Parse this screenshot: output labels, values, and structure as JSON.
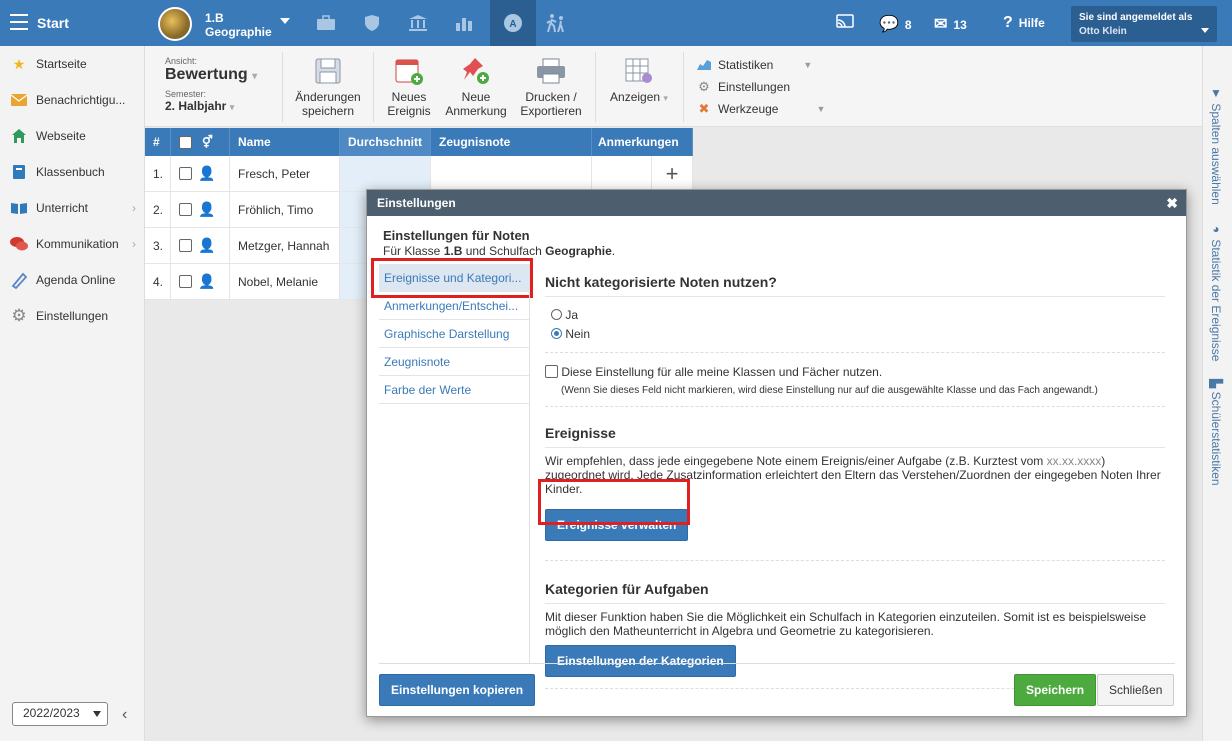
{
  "topbar": {
    "start_label": "Start",
    "class_name": "1.B",
    "subject": "Geographie",
    "messages_count": "8",
    "mail_count": "13",
    "help_label": "Hilfe",
    "logged_in_label": "Sie sind angemeldet als",
    "user_name": "Otto Klein",
    "nav_icons": [
      "briefcase-icon",
      "shield-icon",
      "institution-icon",
      "bar-chart-icon",
      "grade-icon",
      "walking-icon"
    ]
  },
  "sidebar": {
    "items": [
      {
        "label": "Startseite",
        "icon": "star-icon",
        "color": "#f2b51b"
      },
      {
        "label": "Benachrichtigu...",
        "icon": "envelope-icon",
        "color": "#e8a531"
      },
      {
        "label": "Webseite",
        "icon": "home-icon",
        "color": "#2f9a5a"
      },
      {
        "label": "Klassenbuch",
        "icon": "book-icon",
        "color": "#2f7ab8"
      },
      {
        "label": "Unterricht",
        "icon": "open-book-icon",
        "color": "#2f7ab8"
      },
      {
        "label": "Kommunikation",
        "icon": "chat-icon",
        "color": "#d0392e"
      },
      {
        "label": "Agenda Online",
        "icon": "pen-icon",
        "color": "#5a88c6"
      },
      {
        "label": "Einstellungen",
        "icon": "gear-icon",
        "color": "#888888"
      }
    ],
    "year": "2022/2023"
  },
  "toolbar": {
    "view_label": "Ansicht:",
    "view_value": "Bewertung",
    "semester_label": "Semester:",
    "semester_value": "2. Halbjahr",
    "save_line1": "Änderungen",
    "save_line2": "speichern",
    "event_line1": "Neues",
    "event_line2": "Ereignis",
    "note_line1": "Neue",
    "note_line2": "Anmerkung",
    "print_line1": "Drucken /",
    "print_line2": "Exportieren",
    "show_label": "Anzeigen",
    "stats_label": "Statistiken",
    "settings_label": "Einstellungen",
    "tools_label": "Werkzeuge"
  },
  "right_strip": {
    "columns": "Spalten auswählen",
    "stats": "Statistik der Ereignisse",
    "student_stats": "Schülerstatistiken"
  },
  "table": {
    "headers": {
      "num": "#",
      "name": "Name",
      "avg": "Durchschnitt",
      "grade": "Zeugnisnote",
      "notes": "Anmerkungen"
    },
    "rows": [
      {
        "num": "1.",
        "name": "Fresch, Peter"
      },
      {
        "num": "2.",
        "name": "Fröhlich, Timo"
      },
      {
        "num": "3.",
        "name": "Metzger, Hannah"
      },
      {
        "num": "4.",
        "name": "Nobel, Melanie"
      }
    ]
  },
  "modal": {
    "title": "Einstellungen",
    "heading": "Einstellungen für Noten",
    "sub_prefix": "Für Klasse ",
    "sub_class": "1.B",
    "sub_mid": " und Schulfach ",
    "sub_subject": "Geographie",
    "sub_end": ".",
    "nav": [
      "Ereignisse und Kategori...",
      "Anmerkungen/Entschei...",
      "Graphische Darstellung",
      "Zeugnisnote",
      "Farbe der Werte"
    ],
    "section1": {
      "title": "Nicht kategorisierte Noten nutzen?",
      "opt_yes": "Ja",
      "opt_no": "Nein",
      "apply_all": "Diese Einstellung für alle meine Klassen und Fächer nutzen.",
      "apply_hint": "(Wenn Sie dieses Feld nicht markieren, wird diese Einstellung nur auf die ausgewählte Klasse und das Fach angewandt.)"
    },
    "section2": {
      "title": "Ereignisse",
      "text_a": "Wir empfehlen, dass jede eingegebene Note einem Ereignis/einer Aufgabe (z.B. Kurztest vom ",
      "text_date": "xx.xx.xxxx",
      "text_b": ") zugeordnet wird. Jede Zusatzinformation erleichtert den Eltern das Verstehen/Zuordnen der eingegeben Noten Ihrer Kinder.",
      "button": "Ereignisse verwalten"
    },
    "section3": {
      "title": "Kategorien für Aufgaben",
      "text": "Mit dieser Funktion haben Sie die Möglichkeit ein Schulfach in Kategorien einzuteilen. Somit ist es beispielsweise möglich den Matheunterricht in Algebra und Geometrie zu kategorisieren.",
      "button": "Einstellungen der Kategorien"
    },
    "copy_button": "Einstellungen kopieren",
    "save_button": "Speichern",
    "close_button": "Schließen"
  },
  "colors": {
    "primary": "#3b7ab8",
    "header_dark": "#4d5e6e",
    "save_green": "#4caa3f",
    "highlight_red": "#e02020"
  }
}
